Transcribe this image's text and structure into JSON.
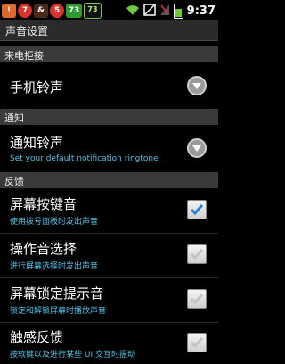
{
  "statusbar": {
    "chips": [
      "!",
      "7",
      "&",
      "5",
      "73",
      "73"
    ],
    "time": "9:37"
  },
  "title": "声音设置",
  "sections": {
    "incoming": "来电拒接",
    "notify": "通知",
    "feedback": "反馈"
  },
  "rows": {
    "ringtone": {
      "title": "手机铃声"
    },
    "notification": {
      "title": "通知铃声",
      "subtitle": "Set your default notification ringtone"
    },
    "dialpad": {
      "title": "屏幕按键音",
      "subtitle": "使用拨号面板时发出声音",
      "checked": true
    },
    "touch_sound": {
      "title": "操作音选择",
      "subtitle": "进行屏幕选择时发出声音",
      "checked": false
    },
    "lock_sound": {
      "title": "屏幕锁定提示音",
      "subtitle": "锁定和解锁屏幕时播放声音",
      "checked": false
    },
    "haptic": {
      "title": "触感反馈",
      "subtitle": "按软键以及进行某些 UI 交互时振动",
      "checked": false
    }
  },
  "colors": {
    "accent": "#4fc3e8",
    "check": "#2a7fd6"
  }
}
